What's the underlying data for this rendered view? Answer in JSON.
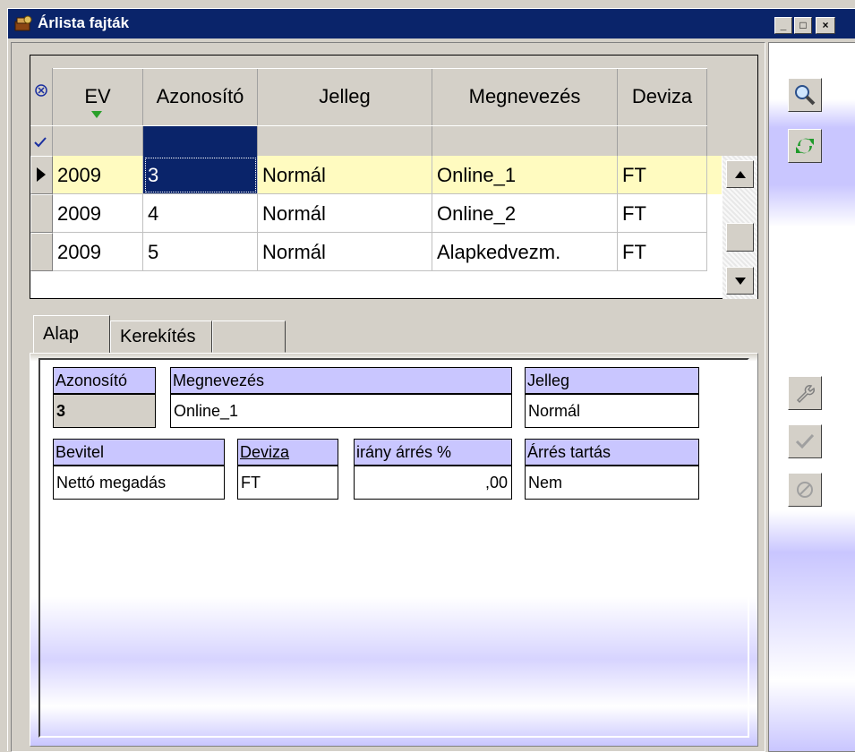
{
  "window": {
    "title": "Árlista fajták",
    "btn_min": "_",
    "btn_max": "□",
    "btn_close": "×"
  },
  "grid": {
    "columns": [
      "EV",
      "Azonosító",
      "Jelleg",
      "Megnevezés",
      "Deviza"
    ],
    "rows": [
      {
        "ev": "2009",
        "id": "3",
        "jelleg": "Normál",
        "megnevezes": "Online_1",
        "deviza": "FT",
        "current": true
      },
      {
        "ev": "2009",
        "id": "4",
        "jelleg": "Normál",
        "megnevezes": "Online_2",
        "deviza": "FT",
        "current": false
      },
      {
        "ev": "2009",
        "id": "5",
        "jelleg": "Normál",
        "megnevezes": "Alapkedvezm.",
        "deviza": "FT",
        "current": false
      }
    ],
    "filter_icon": "clear-filter-icon",
    "check_icon": "check-icon"
  },
  "tabs": [
    "Alap",
    "Kerekítés",
    ""
  ],
  "form": {
    "azonosito_label": "Azonosító",
    "azonosito_value": "3",
    "megnevezes_label": "Megnevezés",
    "megnevezes_value": "Online_1",
    "jelleg_label": "Jelleg",
    "jelleg_value": "Normál",
    "bevitel_label": "Bevitel",
    "bevitel_value": "Nettó megadás",
    "deviza_label": "Deviza",
    "deviza_value": "FT",
    "arres_label": "irány árrés %",
    "arres_value": ",00",
    "tartas_label": "Árrés tartás",
    "tartas_value": "Nem"
  },
  "colors": {
    "title_bar": "#0a246a",
    "current_row": "#fffbc0",
    "selected_cell": "#0a246a",
    "label_bg": "#c9c6ff"
  }
}
